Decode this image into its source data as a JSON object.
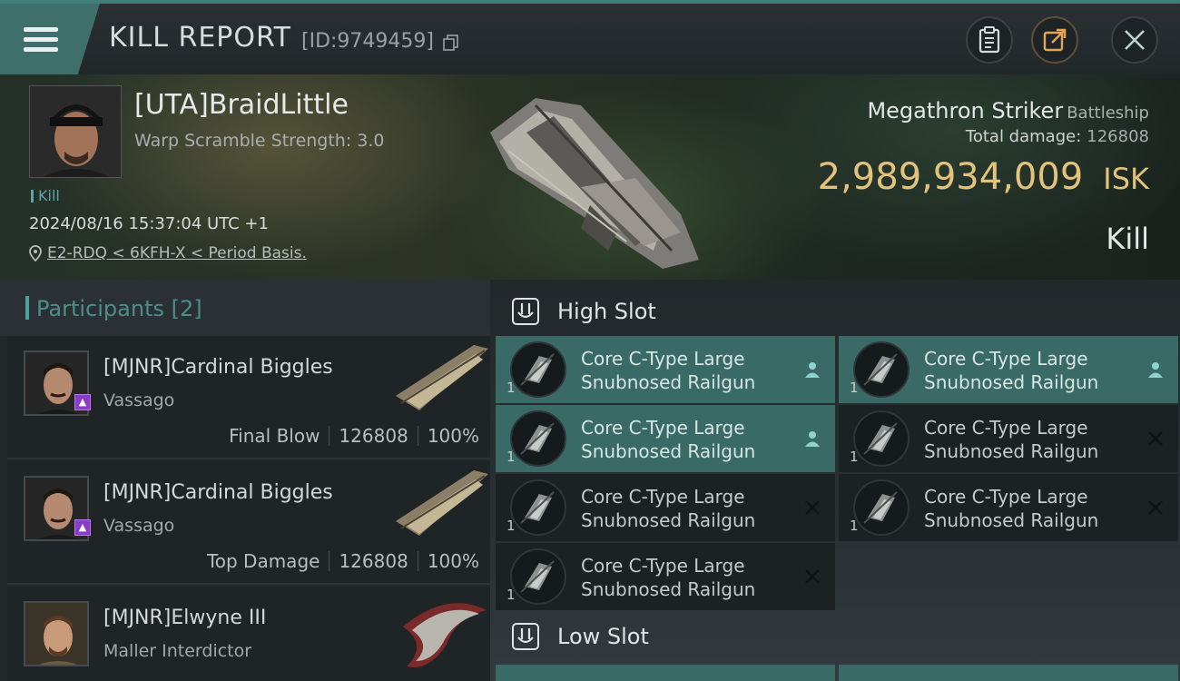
{
  "header": {
    "title": "KILL REPORT",
    "report_id": "[ID:9749459]"
  },
  "victim": {
    "name": "[UTA]BraidLittle",
    "warp_scramble": "Warp Scramble Strength: 3.0",
    "tag": "Kill",
    "timestamp": "2024/08/16 15:37:04 UTC +1",
    "location": "E2-RDQ < 6KFH-X < Period Basis."
  },
  "ship": {
    "name": "Megathron Striker",
    "class": "Battleship",
    "total_damage_label": "Total damage:",
    "total_damage": "126808",
    "isk_value": "2,989,934,009",
    "isk_unit": "ISK",
    "result": "Kill"
  },
  "participants": {
    "title": "Participants [2]",
    "items": [
      {
        "name": "[MJNR]Cardinal Biggles",
        "ship": "Vassago",
        "role": "Final Blow",
        "damage": "126808",
        "percent": "100%"
      },
      {
        "name": "[MJNR]Cardinal Biggles",
        "ship": "Vassago",
        "role": "Top Damage",
        "damage": "126808",
        "percent": "100%"
      },
      {
        "name": "[MJNR]Elwyne III",
        "ship": "Maller Interdictor",
        "role": "",
        "damage": "",
        "percent": ""
      }
    ]
  },
  "fitting": {
    "high_slot_title": "High Slot",
    "low_slot_title": "Low Slot",
    "high_slot": [
      {
        "qty": "1",
        "name_line1": "Core C-Type Large",
        "name_line2": "Snubnosed Railgun",
        "state": "fitted",
        "state_icon": "person-icon"
      },
      {
        "qty": "1",
        "name_line1": "Core C-Type Large",
        "name_line2": "Snubnosed Railgun",
        "state": "fitted",
        "state_icon": "person-icon"
      },
      {
        "qty": "1",
        "name_line1": "Core C-Type Large",
        "name_line2": "Snubnosed Railgun",
        "state": "fitted",
        "state_icon": "person-icon"
      },
      {
        "qty": "1",
        "name_line1": "Core C-Type Large",
        "name_line2": "Snubnosed Railgun",
        "state": "destroyed",
        "state_icon": "x-icon"
      },
      {
        "qty": "1",
        "name_line1": "Core C-Type Large",
        "name_line2": "Snubnosed Railgun",
        "state": "destroyed",
        "state_icon": "x-icon"
      },
      {
        "qty": "1",
        "name_line1": "Core C-Type Large",
        "name_line2": "Snubnosed Railgun",
        "state": "destroyed",
        "state_icon": "x-icon"
      },
      {
        "qty": "1",
        "name_line1": "Core C-Type Large",
        "name_line2": "Snubnosed Railgun",
        "state": "destroyed",
        "state_icon": "x-icon"
      }
    ]
  },
  "colors": {
    "accent": "#3e6f6b",
    "isk": "#e3c27b",
    "active_module": "#3a6a66",
    "participant_title": "#4c8f8a"
  }
}
